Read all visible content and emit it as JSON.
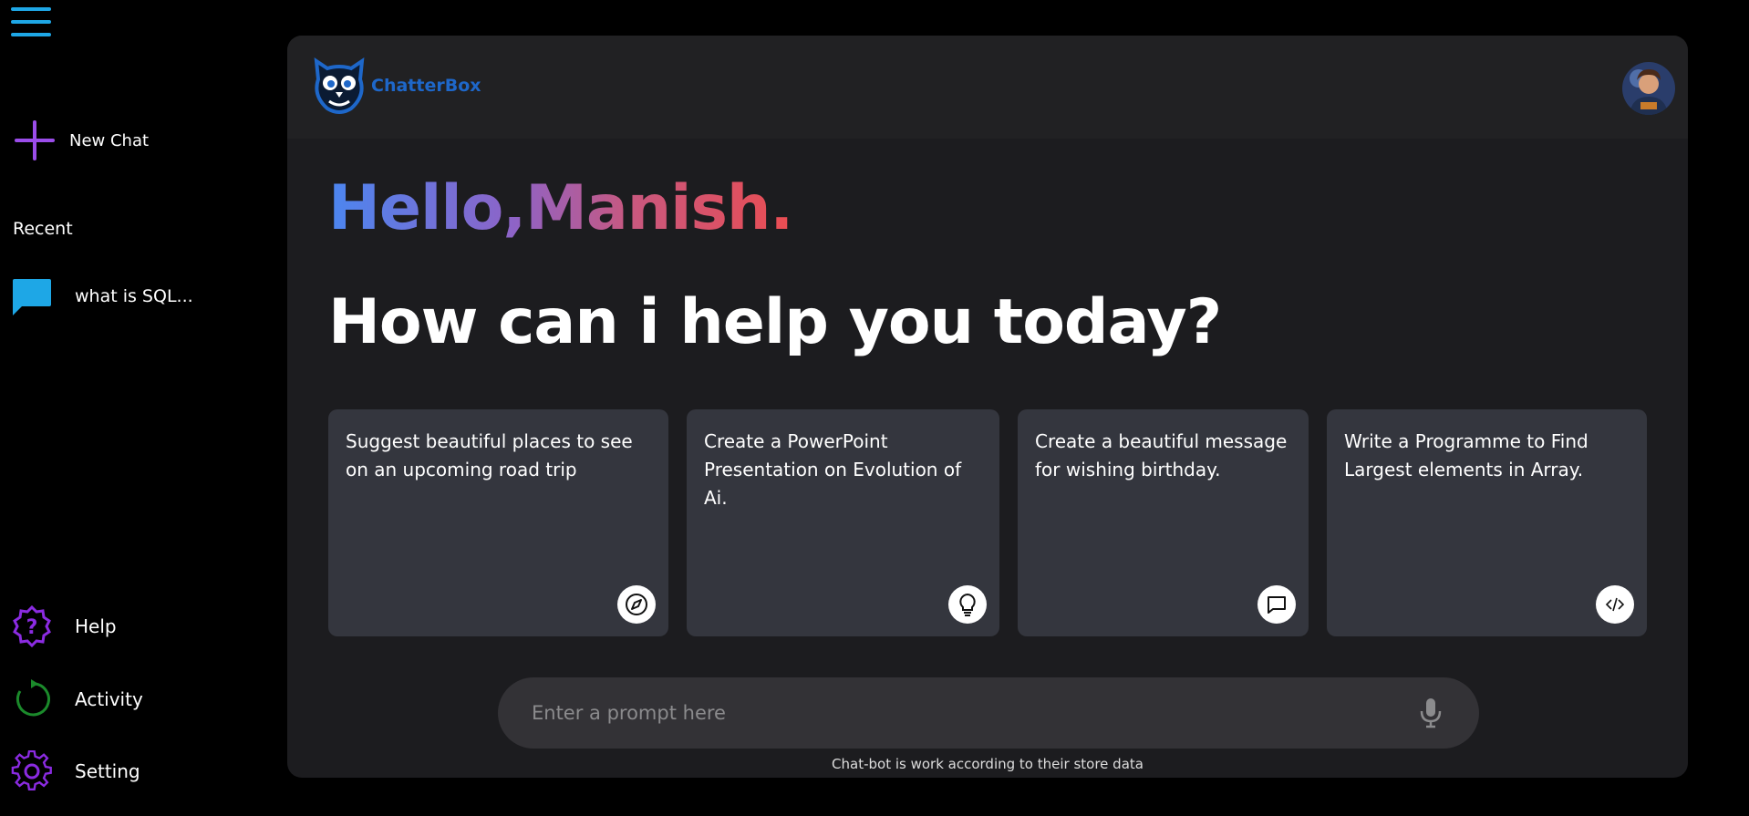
{
  "sidebar": {
    "new_chat_label": "New Chat",
    "recent_title": "Recent",
    "recent_items": [
      {
        "label": "what is SQL..."
      }
    ],
    "bottom_items": [
      {
        "label": "Help",
        "icon": "help-icon"
      },
      {
        "label": "Activity",
        "icon": "activity-icon"
      },
      {
        "label": "Setting",
        "icon": "gear-icon"
      }
    ],
    "accent_color": "#9b4dea",
    "menu_color": "#1ea7e6"
  },
  "header": {
    "brand_name": "ChatterBox",
    "brand_color": "#1e67c9"
  },
  "greeting": {
    "hello": "Hello,Manish.",
    "question": "How can i help you today?"
  },
  "cards": [
    {
      "text": "Suggest beautiful places to see on an upcoming road trip",
      "icon": "compass-icon"
    },
    {
      "text": "Create a PowerPoint Presentation on Evolution of Ai.",
      "icon": "lightbulb-icon"
    },
    {
      "text": "Create a beautiful message for wishing birthday.",
      "icon": "message-icon"
    },
    {
      "text": "Write a Programme to Find Largest elements in Array.",
      "icon": "code-icon"
    }
  ],
  "prompt": {
    "placeholder": "Enter a prompt here",
    "note": "Chat-bot is work according to their store data"
  }
}
